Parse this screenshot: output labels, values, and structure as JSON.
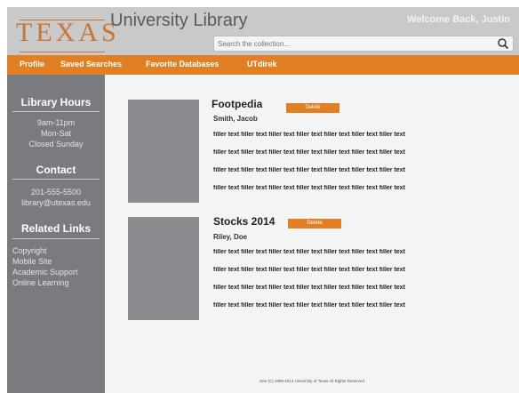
{
  "header": {
    "logo_text": "TEXAS",
    "title": "University Library",
    "welcome": "Welcome Back, Justin"
  },
  "search": {
    "placeholder": "Search the collection..."
  },
  "nav": {
    "items": [
      "Profile",
      "Saved Searches",
      "Favorite Databases",
      "UTdirek"
    ]
  },
  "sidebar": {
    "hours_heading": "Library Hours",
    "hours_lines": [
      "9am-11pm",
      "Mon-Sat",
      "Closed Sunday"
    ],
    "contact_heading": "Contact",
    "contact_lines": [
      "201-555-5500",
      "library@utexas.edu"
    ],
    "links_heading": "Related Links",
    "links": [
      "Copyright",
      "Mobile Site",
      "Academic Support",
      "Online Learning"
    ]
  },
  "entries": [
    {
      "title": "Footpedia",
      "author": "Smith, Jacob",
      "delete_label": "Delete",
      "lines": [
        "filler text filler text filler text filler text filler text filler text filler text",
        "filler text filler text filler text filler text filler text filler text filler text",
        "filler text filler text filler text filler text filler text filler text filler text",
        "filler text filler text filler text filler text filler text filler text filler text"
      ]
    },
    {
      "title": "Stocks 2014",
      "author": "Riley, Doe",
      "delete_label": "Delete",
      "lines": [
        "filler text filler text filler text filler text filler text filler text filler text",
        "filler text filler text filler text filler text filler text filler text filler text",
        "filler text filler text filler text filler text filler text filler text filler text",
        "filler text filler text filler text filler text filler text filler text filler text"
      ]
    }
  ],
  "footer": {
    "text": "See (C) 1999-2014 University of Texas All Rights Reserved"
  },
  "colors": {
    "accent": "#e07f23",
    "sidebar": "#7a7a80",
    "header": "#c9c9c9"
  }
}
